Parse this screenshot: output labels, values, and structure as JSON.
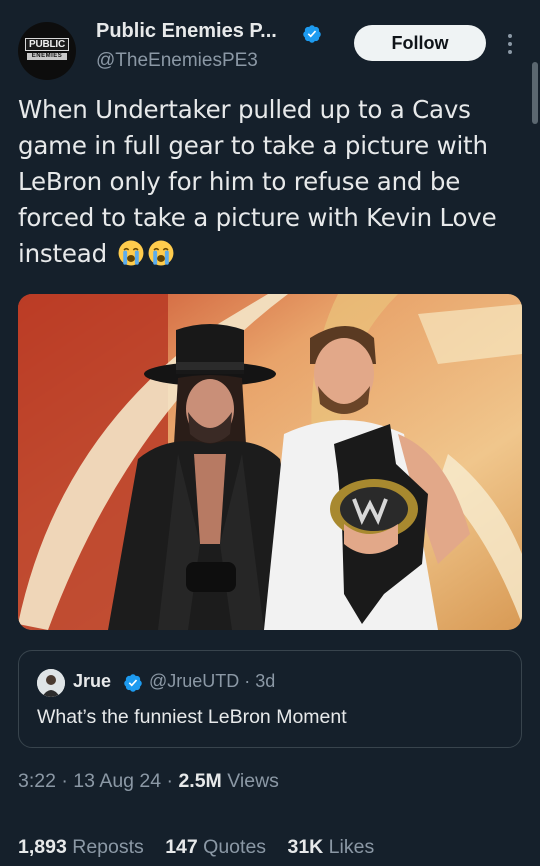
{
  "author": {
    "name": "Public Enemies P...",
    "handle": "@TheEnemiesPE3",
    "avatar_text": "PUBLIC",
    "avatar_subtext": "ENEMIES"
  },
  "follow_label": "Follow",
  "tweet_text": "When Undertaker pulled up to a Cavs game in full gear to take a picture with LeBron only for him to refuse and be forced to take a picture with Kevin Love instead",
  "tweet_emojis": [
    "loudly-crying-face",
    "loudly-crying-face"
  ],
  "quote": {
    "name": "Jrue",
    "handle_time": "@JrueUTD · 3d",
    "text": "What’s the funniest LeBron Moment"
  },
  "meta": {
    "time_date": "3:22 · 13 Aug 24 · ",
    "views_count": "2.5M",
    "views_label": "Views"
  },
  "stats": {
    "reposts_count": "1,893",
    "reposts_label": "Reposts",
    "quotes_count": "147",
    "quotes_label": "Quotes",
    "likes_count": "31K",
    "likes_label": "Likes"
  },
  "colors": {
    "background": "#15202b",
    "verified": "#1d9bf0",
    "text_secondary": "#8b98a5",
    "follow_bg": "#eff3f4"
  }
}
